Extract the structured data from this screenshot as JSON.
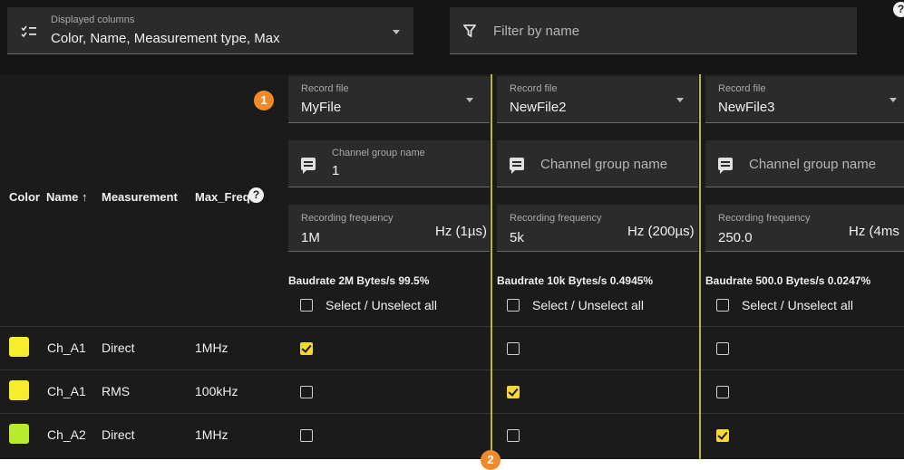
{
  "toolbar": {
    "columns_label": "Displayed columns",
    "columns_value": "Color, Name, Measurement type, Max",
    "filter_placeholder": "Filter by name",
    "help_glyph": "?"
  },
  "table": {
    "headers": {
      "color": "Color",
      "name": "Name ↑",
      "measurement": "Measurement",
      "max_freq": "Max_Freq",
      "help_glyph": "?"
    },
    "rows": [
      {
        "color": "#f6ee2c",
        "name": "Ch_A1",
        "measurement": "Direct",
        "max_freq": "1MHz"
      },
      {
        "color": "#f6ee2c",
        "name": "Ch_A1",
        "measurement": "RMS",
        "max_freq": "100kHz"
      },
      {
        "color": "#b7ec2e",
        "name": "Ch_A2",
        "measurement": "Direct",
        "max_freq": "1MHz"
      }
    ]
  },
  "records": [
    {
      "file_label": "Record file",
      "file_value": "MyFile",
      "group_label": "Channel group name",
      "group_value": "1",
      "group_placeholder": "",
      "freq_label": "Recording frequency",
      "freq_value": "1M",
      "freq_unit": "Hz (1µs)",
      "baudrate": "Baudrate 2M Bytes/s 99.5%",
      "select_all": "Select / Unselect all",
      "checks": [
        true,
        false,
        false
      ]
    },
    {
      "file_label": "Record file",
      "file_value": "NewFile2",
      "group_label": "",
      "group_value": "",
      "group_placeholder": "Channel group name",
      "freq_label": "Recording frequency",
      "freq_value": "5k",
      "freq_unit": "Hz (200µs)",
      "baudrate": "Baudrate 10k Bytes/s 0.4945%",
      "select_all": "Select / Unselect all",
      "checks": [
        false,
        true,
        false
      ]
    },
    {
      "file_label": "Record file",
      "file_value": "NewFile3",
      "group_label": "",
      "group_value": "",
      "group_placeholder": "Channel group name",
      "freq_label": "Recording frequency",
      "freq_value": "250.0",
      "freq_unit": "Hz (4ms",
      "baudrate": "Baudrate 500.0 Bytes/s 0.0247%",
      "select_all": "Select / Unselect all",
      "checks": [
        false,
        false,
        true
      ]
    }
  ],
  "callouts": {
    "one": "1",
    "two": "2"
  },
  "colors": {
    "accent_yellow": "#f5d832",
    "callout_orange": "#ef8a2a",
    "divider": "#bdb536"
  }
}
